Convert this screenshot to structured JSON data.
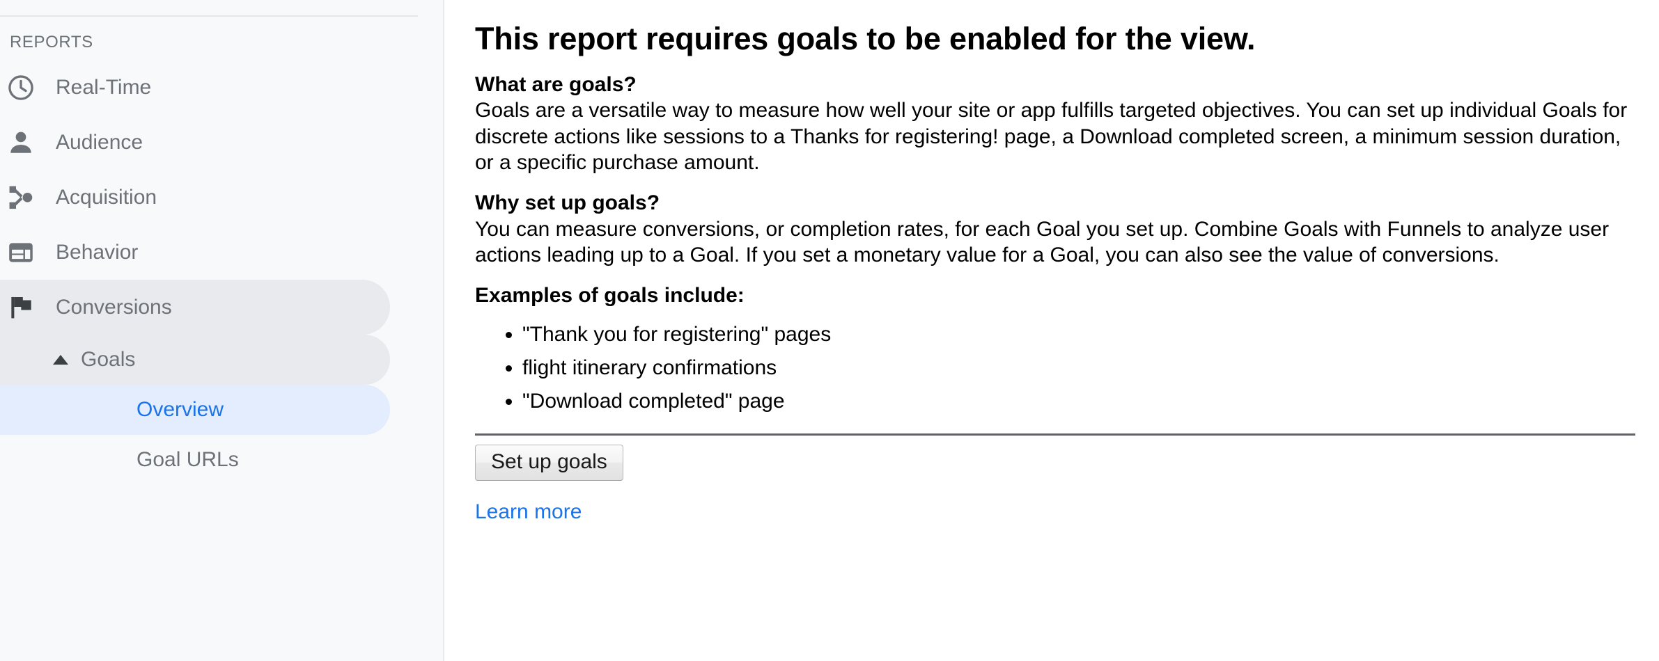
{
  "sidebar": {
    "section_label": "REPORTS",
    "items": [
      {
        "label": "Real-Time",
        "icon": "clock-icon",
        "state": "normal",
        "level": 0
      },
      {
        "label": "Audience",
        "icon": "person-icon",
        "state": "normal",
        "level": 0
      },
      {
        "label": "Acquisition",
        "icon": "acquisition-icon",
        "state": "normal",
        "level": 0
      },
      {
        "label": "Behavior",
        "icon": "behavior-icon",
        "state": "normal",
        "level": 0
      },
      {
        "label": "Conversions",
        "icon": "flag-icon",
        "state": "expanded-parent",
        "level": 0
      },
      {
        "label": "Goals",
        "icon": "caret-up-icon",
        "state": "expanded-parent",
        "level": 1
      },
      {
        "label": "Overview",
        "icon": "none",
        "state": "active",
        "level": 2
      },
      {
        "label": "Goal URLs",
        "icon": "none",
        "state": "normal",
        "level": 2
      }
    ]
  },
  "main": {
    "title": "This report requires goals to be enabled for the view.",
    "sections": [
      {
        "heading": "What are goals?",
        "body": "Goals are a versatile way to measure how well your site or app fulfills targeted objectives. You can set up individual Goals for discrete actions like sessions to a Thanks for registering! page, a Download completed screen, a minimum session duration, or a specific purchase amount."
      },
      {
        "heading": "Why set up goals?",
        "body": "You can measure conversions, or completion rates, for each Goal you set up. Combine Goals with Funnels to analyze user actions leading up to a Goal. If you set a monetary value for a Goal, you can also see the value of conversions."
      }
    ],
    "examples_heading": "Examples of goals include:",
    "examples": [
      "\"Thank you for registering\" pages",
      "flight itinerary confirmations",
      "\"Download completed\" page"
    ],
    "setup_button_label": "Set up goals",
    "learn_more_label": "Learn more"
  },
  "colors": {
    "sidebar_bg": "#f8f9fa",
    "selected_group_bg": "#e8eaed",
    "active_leaf_bg": "#e3edfd",
    "accent_blue": "#1a73e8",
    "icon_gray": "#6d7278",
    "flag_dark": "#3c4043",
    "text_gray": "#6d7278",
    "rule_gray": "#5f6368"
  }
}
